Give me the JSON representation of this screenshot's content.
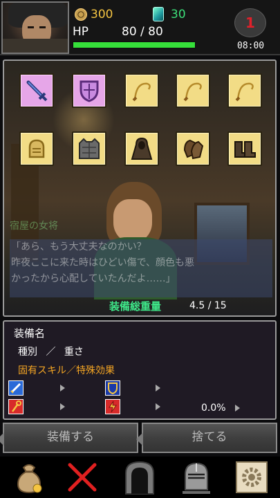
{
  "header": {
    "gold": "300",
    "gems": "30",
    "hp_label": "HP",
    "hp_value": "80 / 80",
    "hp_fraction": 1.0,
    "badge": "1",
    "time": "08:00"
  },
  "equipment": {
    "slots_row1": [
      {
        "icon": "sword-icon",
        "selected": true
      },
      {
        "icon": "shield-icon",
        "selected": true
      },
      {
        "icon": "whip-icon",
        "selected": false
      },
      {
        "icon": "whip-icon",
        "selected": false
      },
      {
        "icon": "whip-icon",
        "selected": false
      }
    ],
    "slots_row2": [
      {
        "icon": "helmet-icon",
        "selected": false
      },
      {
        "icon": "armor-vest-icon",
        "selected": false
      },
      {
        "icon": "cloak-icon",
        "selected": false
      },
      {
        "icon": "gloves-icon",
        "selected": false
      },
      {
        "icon": "boots-icon",
        "selected": false
      }
    ],
    "speaker": "宿屋の女将",
    "dialog_lines": [
      "「あら、もう大丈夫なのかい？",
      "昨夜ここに来た時はひどい傷で、顔色も悪",
      "かったから心配していたんだよ……」"
    ],
    "weight_label": "装備総重量",
    "weight_value": "4.5 / 15"
  },
  "details": {
    "name": "装備名",
    "type_weight": "種別 ／ 重さ",
    "skill": "固有スキル／特殊効果",
    "crit_percent": "0.0%"
  },
  "buttons": {
    "equip": "装備する",
    "discard": "捨てる"
  },
  "nav": [
    "bag-icon",
    "close-x-icon",
    "dungeon-door-icon",
    "knight-helmet-icon",
    "gear-icon"
  ],
  "colors": {
    "gold": "#f5c542",
    "gem": "#3de07a",
    "hp_bar": "#36e03a",
    "slot_bg": "#f2dc86",
    "slot_selected_bg": "#e6a6e8",
    "skill_text": "#f5a623",
    "badge_text": "#e0202a"
  }
}
